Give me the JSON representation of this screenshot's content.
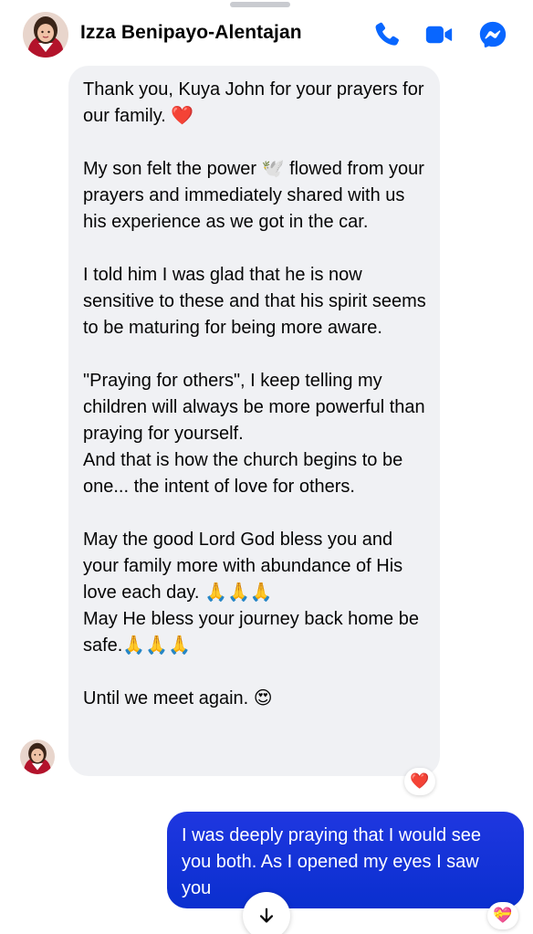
{
  "header": {
    "contact_name": "Izza Benipayo-Alentajan",
    "call_icon": "phone-icon",
    "video_icon": "video-camera-icon",
    "messenger_icon": "messenger-icon",
    "accent_color": "#0866ff"
  },
  "incoming_message": {
    "paragraphs": [
      "Thank you, Kuya John for your prayers for our family. ❤️",
      "My son felt the power 🕊️ flowed from your prayers and immediately shared with us his experience as we got in the car.",
      "I told him I was glad that he is now sensitive to these and that his spirit seems to be maturing for being more aware.",
      "\"Praying for others\", I keep telling my children will always be more powerful than praying for yourself.\nAnd that is how the church begins to be one... the intent of love for others.",
      "May the good Lord God bless you and your family more with abundance of His love each day. 🙏🙏🙏\nMay He bless your journey back home be safe.🙏🙏🙏",
      "Until we meet again. 😍"
    ],
    "reaction": "❤️"
  },
  "outgoing_message": {
    "text": "I was deeply praying that I would see you both. As I opened my eyes I saw you",
    "reaction": "💝",
    "bubble_color": "#0a2fcf"
  },
  "scroll_down_icon": "arrow-down-icon"
}
